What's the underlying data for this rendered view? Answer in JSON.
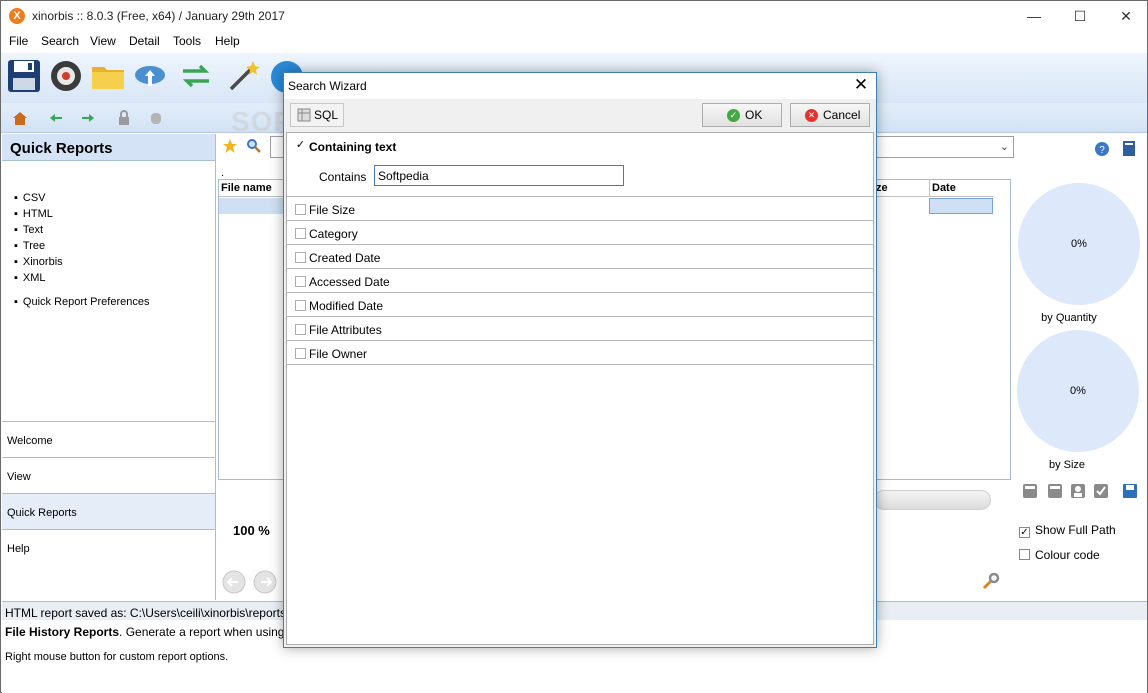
{
  "window": {
    "title": "xinorbis :: 8.0.3 (Free, x64) / January 29th 2017",
    "logo_letter": "X",
    "minimize": "—",
    "maximize": "☐",
    "close": "✕"
  },
  "menu": [
    "File",
    "Search",
    "View",
    "Detail",
    "Tools",
    "Help"
  ],
  "toolbar": {
    "icons": [
      "save-icon",
      "scan-icon",
      "folder-icon",
      "cloud-upload-icon",
      "sync-icon",
      "magic-wand-icon",
      "info-icon"
    ]
  },
  "toolbar2": {
    "icons": [
      "home-icon",
      "back-arrow-icon",
      "forward-arrow-icon",
      "lock-icon",
      "database-icon"
    ]
  },
  "quick_reports": {
    "title": "Quick Reports",
    "items": [
      "CSV",
      "HTML",
      "Text",
      "Tree",
      "Xinorbis",
      "XML"
    ],
    "preferences": "Quick Report Preferences"
  },
  "nav": [
    "Welcome",
    "View",
    "Quick Reports",
    "Help"
  ],
  "table": {
    "columns": [
      "File name",
      "ze",
      "Date"
    ],
    "dot": "."
  },
  "progress": {
    "percent_label": "100 %"
  },
  "charts": [
    {
      "value": "0%",
      "caption": "by Quantity"
    },
    {
      "value": "0%",
      "caption": "by Size"
    }
  ],
  "options": [
    {
      "label": "Show Full Path",
      "checked": true
    },
    {
      "label": "Colour code",
      "checked": false
    }
  ],
  "status": {
    "line1": "HTML report saved as: C:\\Users\\ceili\\xinorbis\\reports",
    "line2_bold": "File History Reports",
    "line2_rest": ". Generate a report when using Fol",
    "line3": "Right mouse button for custom report options."
  },
  "dialog": {
    "title": "Search Wizard",
    "sql_label": "SQL",
    "ok_label": "OK",
    "cancel_label": "Cancel",
    "containing_text_label": "Containing text",
    "contains_label": "Contains",
    "contains_value": "Softpedia",
    "criteria": [
      "File Size",
      "Category",
      "Created Date",
      "Accessed Date",
      "Modified Date",
      "File Attributes",
      "File Owner"
    ]
  },
  "watermark": "SOFTPEDIA",
  "colors": {
    "accent": "#3c7fb1",
    "panel": "#d4e3f5",
    "pie": "#dde8fb"
  }
}
